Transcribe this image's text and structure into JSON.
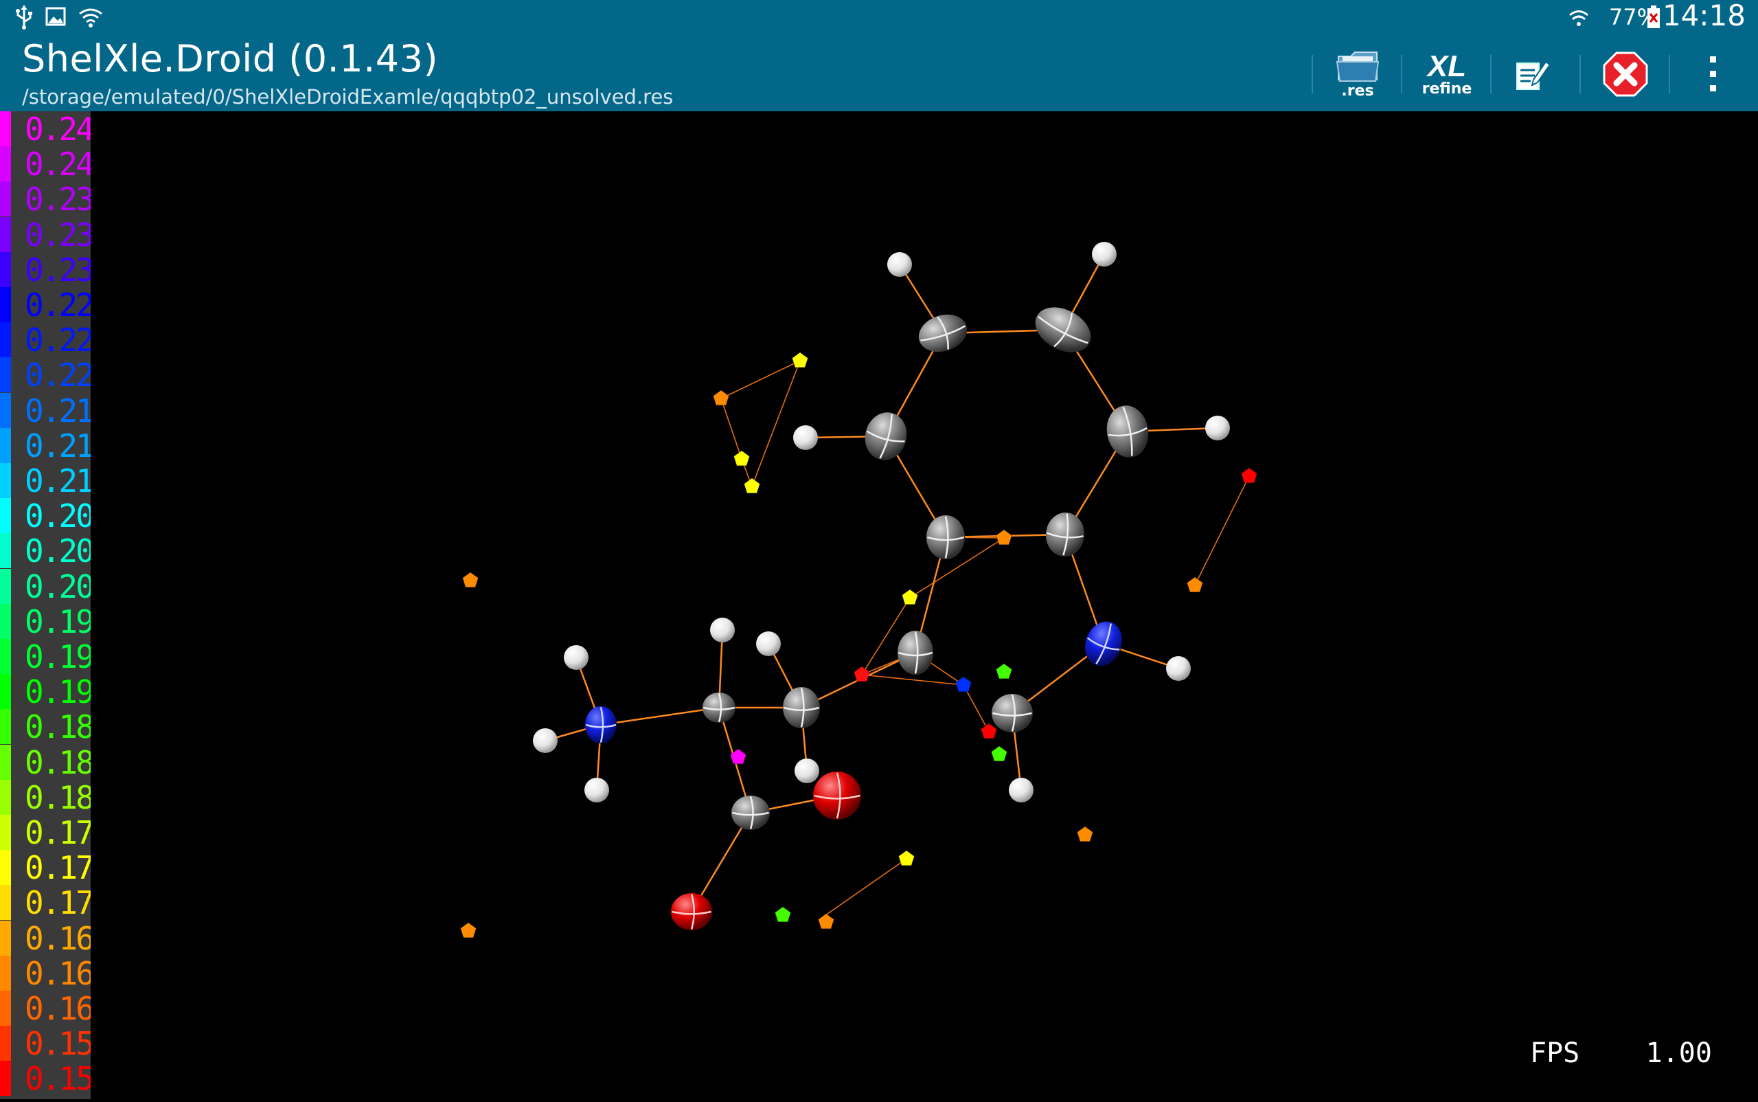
{
  "status_bar": {
    "left_icons": [
      "usb-icon",
      "image-icon",
      "wifi-icon"
    ],
    "battery_pct": "77%",
    "time": "14:18"
  },
  "app": {
    "title": "ShelXle.Droid (0.1.43)",
    "subtitle": "/storage/emulated/0/ShelXleDroidExamle/qqqbtp02_unsolved.res",
    "background_color": "#036789"
  },
  "actions": {
    "res_caption": ".res",
    "xl_label": "XL",
    "xl_caption": "refine"
  },
  "legend": [
    {
      "label": "0.24",
      "color": "#ff00ff"
    },
    {
      "label": "0.24",
      "color": "#d800ff"
    },
    {
      "label": "0.23",
      "color": "#b000ff"
    },
    {
      "label": "0.23",
      "color": "#7a00ff"
    },
    {
      "label": "0.23",
      "color": "#3c00ff"
    },
    {
      "label": "0.22",
      "color": "#0000ff"
    },
    {
      "label": "0.22",
      "color": "#0018ff"
    },
    {
      "label": "0.22",
      "color": "#0040ff"
    },
    {
      "label": "0.21",
      "color": "#0070ff"
    },
    {
      "label": "0.21",
      "color": "#00a0ff"
    },
    {
      "label": "0.21",
      "color": "#00d0ff"
    },
    {
      "label": "0.20",
      "color": "#00ffff"
    },
    {
      "label": "0.20",
      "color": "#00ffcc"
    },
    {
      "label": "0.20",
      "color": "#00ff99"
    },
    {
      "label": "0.19",
      "color": "#00ff66"
    },
    {
      "label": "0.19",
      "color": "#00ff33"
    },
    {
      "label": "0.19",
      "color": "#00ff00"
    },
    {
      "label": "0.18",
      "color": "#33ff00"
    },
    {
      "label": "0.18",
      "color": "#66ff00"
    },
    {
      "label": "0.18",
      "color": "#99ff00"
    },
    {
      "label": "0.17",
      "color": "#ccff00"
    },
    {
      "label": "0.17",
      "color": "#ffff00"
    },
    {
      "label": "0.17",
      "color": "#ffdd00"
    },
    {
      "label": "0.16",
      "color": "#ffaa00"
    },
    {
      "label": "0.16",
      "color": "#ff8800"
    },
    {
      "label": "0.16",
      "color": "#ff6600"
    },
    {
      "label": "0.15",
      "color": "#ff3300"
    },
    {
      "label": "0.15",
      "color": "#ff0000"
    }
  ],
  "fps": {
    "label": "FPS",
    "value": "1.00"
  }
}
